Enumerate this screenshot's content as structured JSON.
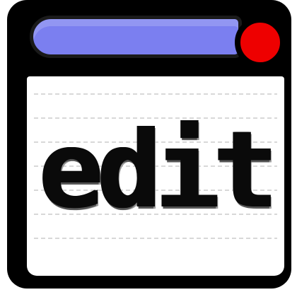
{
  "window": {
    "content_label": "edit"
  },
  "icons": {
    "title_bar": "title-bar",
    "close": "close-icon"
  },
  "colors": {
    "frame": "#000000",
    "title_bar": "#7b7ff0",
    "close_button": "#ee0000",
    "content_background": "#ffffff",
    "text": "#0a0a0a"
  }
}
